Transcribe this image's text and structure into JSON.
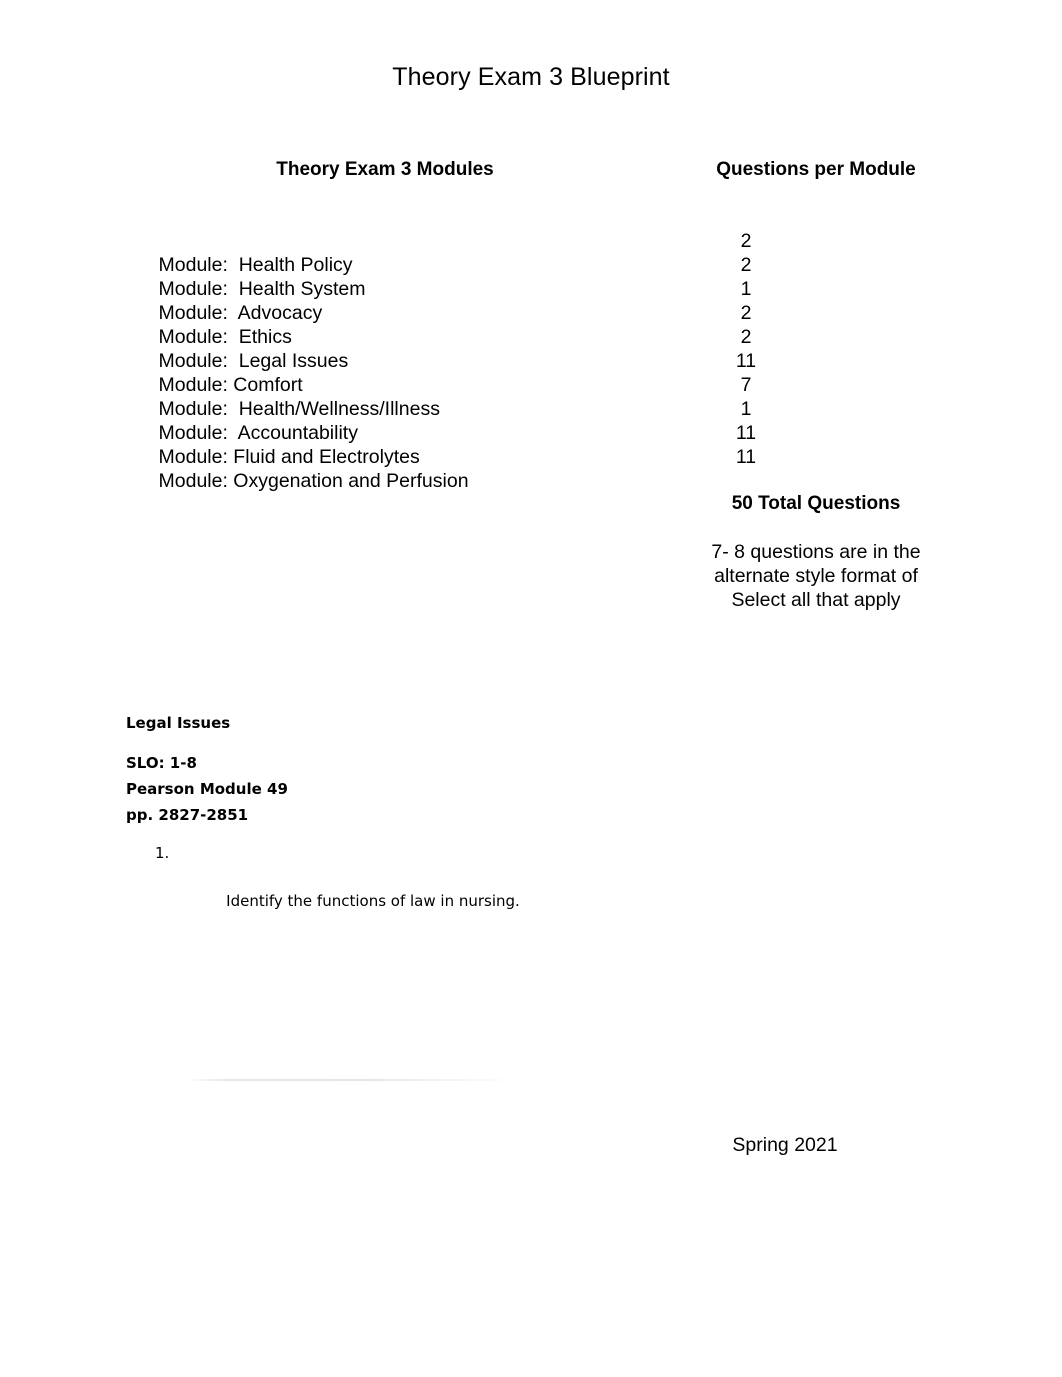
{
  "document": {
    "title": "Theory Exam 3 Blueprint",
    "footer_term": "Spring 2021"
  },
  "table": {
    "header_modules": "Theory Exam 3 Modules",
    "header_questions": "Questions per Module",
    "rows": [
      {
        "module": "Module:  Health Policy",
        "count": "2"
      },
      {
        "module": "Module:  Health System",
        "count": "2"
      },
      {
        "module": "Module:  Advocacy",
        "count": "1"
      },
      {
        "module": "Module:  Ethics",
        "count": "2"
      },
      {
        "module": "Module:  Legal Issues",
        "count": "2"
      },
      {
        "module": "Module: Comfort",
        "count": "11"
      },
      {
        "module": "Module:  Health/Wellness/Illness",
        "count": "7"
      },
      {
        "module": "Module:  Accountability",
        "count": "1"
      },
      {
        "module": "Module: Fluid and Electrolytes",
        "count": "11"
      },
      {
        "module": "Module: Oxygenation and Perfusion",
        "count": "11"
      }
    ]
  },
  "totals": {
    "total_questions": "50 Total Questions",
    "alternate_note_lines": [
      "7- 8 questions are in the",
      "alternate style format of",
      "Select all that apply"
    ]
  },
  "legal_section": {
    "heading": "Legal Issues",
    "slo": "SLO: 1-8",
    "source_module": "Pearson Module 49",
    "pages": "pp. 2827-2851",
    "objectives": [
      {
        "marker": "1.",
        "text": "Identify the functions of law in nursing."
      }
    ]
  }
}
